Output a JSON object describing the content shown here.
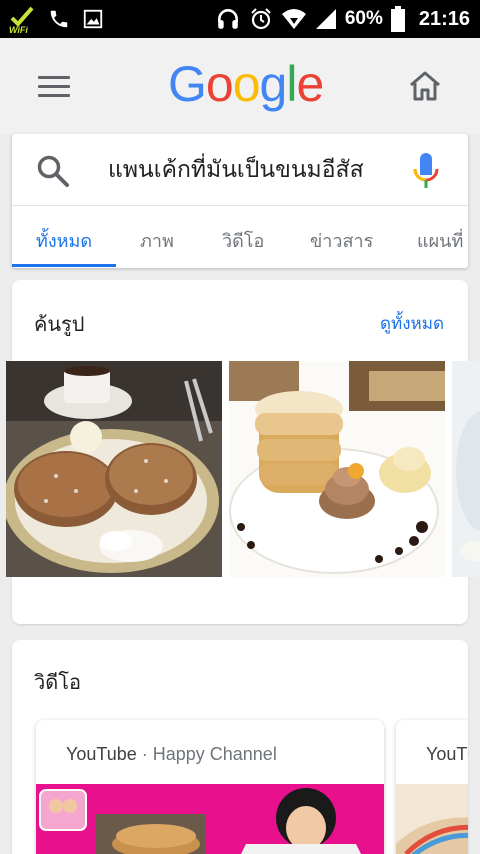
{
  "status_bar": {
    "wifi_label": "WiFi",
    "battery": "60%",
    "time": "21:16",
    "icons": [
      "wifi-icon",
      "phone-icon",
      "gallery-icon",
      "headset-icon",
      "alarm-icon",
      "wifi-signal-icon",
      "cell-signal-icon",
      "battery-icon"
    ]
  },
  "header": {
    "logo": {
      "G": "G",
      "o1": "o",
      "o2": "o",
      "g": "g",
      "l": "l",
      "e": "e"
    },
    "menu_icon": "hamburger-menu-icon",
    "home_icon": "home-icon"
  },
  "search": {
    "query": "แพนเค้กที่มันเป็นขนมอีสัส",
    "search_icon": "search-icon",
    "mic_icon": "microphone-icon"
  },
  "tabs": [
    {
      "label": "ทั้งหมด",
      "active": true
    },
    {
      "label": "ภาพ",
      "active": false
    },
    {
      "label": "วิดีโอ",
      "active": false
    },
    {
      "label": "ข่าวสาร",
      "active": false
    },
    {
      "label": "แผนที่",
      "active": false
    }
  ],
  "images_section": {
    "title": "ค้นรูป",
    "see_all": "ดูทั้งหมด"
  },
  "videos_section": {
    "title": "วิดีโอ",
    "items": [
      {
        "source": "YouTube",
        "separator": " · ",
        "channel": "Happy Channel"
      },
      {
        "source": "YouTube",
        "separator": "",
        "channel": ""
      }
    ]
  },
  "colors": {
    "accent": "#1a73e8",
    "google_blue": "#4285f4",
    "google_red": "#ea4335",
    "google_yellow": "#fbbc05",
    "google_green": "#34a853",
    "background": "#ececec"
  }
}
